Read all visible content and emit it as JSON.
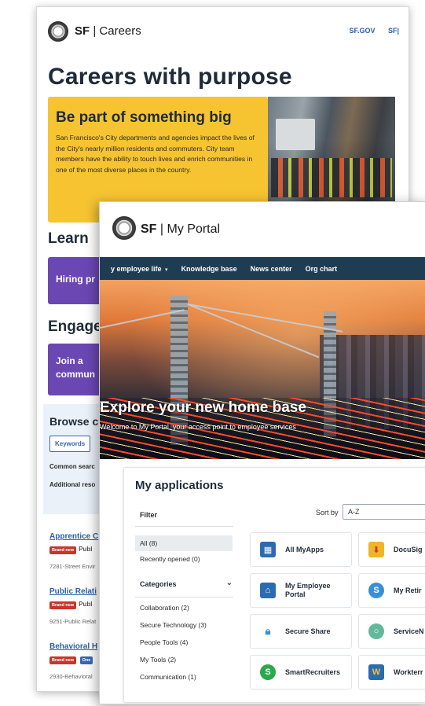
{
  "careers": {
    "brand_bold": "SF",
    "brand_rest": " | Careers",
    "links": [
      "SF.GOV",
      "SF|"
    ],
    "title": "Careers with purpose",
    "hero_heading": "Be part of something big",
    "hero_text": "San Francisco's City departments and agencies impact the lives of the City's nearly million residents and commuters. City team members have the ability to touch lives and enrich communities in one of the most diverse places in the country.",
    "learn_heading": "Learn",
    "learn_card": "Hiring pr",
    "engage_heading": "Engage",
    "engage_card": "Join a commun",
    "browse_heading": "Browse c",
    "browse_tab": "Keywords",
    "browse_row1": "Common searc",
    "browse_row2": "Additional reso",
    "jobs": [
      {
        "title": "Apprentice C",
        "badge": "Brand new",
        "badge2": "",
        "pub": "Publ",
        "code": "7281-Street Envir"
      },
      {
        "title": "Public Relati",
        "badge": "Brand new",
        "badge2": "",
        "pub": "Publ",
        "code": "9251-Public Relat"
      },
      {
        "title": "Behavioral H",
        "badge": "Brand new",
        "badge2": "One",
        "pub": "",
        "code": "2930-Behavioral"
      }
    ]
  },
  "portal": {
    "brand_bold": "SF",
    "brand_rest": " | My Portal",
    "nav": [
      {
        "label": "y employee life",
        "caret": "▾"
      },
      {
        "label": "Knowledge base",
        "caret": ""
      },
      {
        "label": "News center",
        "caret": ""
      },
      {
        "label": "Org chart",
        "caret": ""
      }
    ],
    "hero_title": "Explore your new home base",
    "hero_sub": "Welcome to My Portal, your access point to employee services",
    "apps_heading": "My applications",
    "filter_label": "Filter",
    "sort_label": "Sort by",
    "sort_value": "A-Z",
    "filters": [
      "All (8)",
      "Recently opened (0)"
    ],
    "categories_label": "Categories",
    "categories": [
      "Collaboration (2)",
      "Secure Technology (3)",
      "People Tools (4)",
      "My Tools (2)",
      "Communication (1)"
    ],
    "apps": [
      {
        "name": "All MyApps",
        "icon": "grid-icon",
        "color": "#2b6cb0"
      },
      {
        "name": "DocuSig",
        "icon": "download-icon",
        "color": "#f0b429"
      },
      {
        "name": "My Employee Portal",
        "icon": "city-hall-icon",
        "color": "#2b6cb0"
      },
      {
        "name": "My Retir",
        "icon": "s-logo-icon",
        "color": "#3a8fd9"
      },
      {
        "name": "Secure Share",
        "icon": "lock-icon",
        "color": "#3a8fd9"
      },
      {
        "name": "ServiceN",
        "icon": "servicenow-icon",
        "color": "#62b89a"
      },
      {
        "name": "SmartRecruiters",
        "icon": "smartrecruiters-icon",
        "color": "#2aa84a"
      },
      {
        "name": "Workterr",
        "icon": "workterra-icon",
        "color": "#2b6cb0"
      }
    ]
  }
}
